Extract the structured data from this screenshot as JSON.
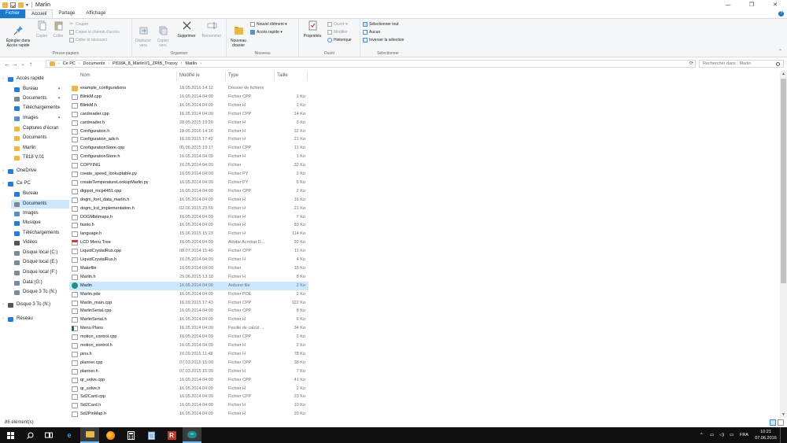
{
  "window": {
    "title": "Marlin",
    "minimize": "—",
    "maximize": "❐",
    "close": "✕"
  },
  "ribbon_tabs": [
    "Fichier",
    "Accueil",
    "Partage",
    "Affichage"
  ],
  "ribbon": {
    "presse_papiers": {
      "label": "Presse-papiers",
      "pin": "Épingler dans\nAccès rapide",
      "copy": "Copier",
      "paste": "Coller",
      "cut": "Couper",
      "copy_path": "Copier le chemin d'accès",
      "paste_shortcut": "Coller le raccourci"
    },
    "organiser": {
      "label": "Organiser",
      "move": "Déplacer\nvers",
      "copy_to": "Copier\nvers",
      "delete": "Supprimer",
      "rename": "Renommer"
    },
    "nouveau": {
      "label": "Nouveau",
      "new_folder": "Nouveau\ndossier",
      "new_item": "Nouvel élément ▾",
      "quick_access": "Accès rapide ▾"
    },
    "ouvrir": {
      "label": "Ouvrir",
      "properties": "Propriétés",
      "open": "Ouvrir ▾",
      "edit": "Modifier",
      "history": "Historique"
    },
    "selectionner": {
      "label": "Sélectionner",
      "select_all": "Sélectionner tout",
      "none": "Aucun",
      "invert": "Inverser la sélection"
    }
  },
  "address": {
    "back": "←",
    "forward": "→",
    "recent": "⌄",
    "up": "↑",
    "crumbs": [
      "Ce PC",
      "Documents",
      "P818A_8_MarlinV1_ZRIB_Tronxy",
      "Marlin"
    ],
    "search_placeholder": "Rechercher dans : Marlin"
  },
  "nav": [
    {
      "label": "Accès rapide",
      "icon": "star-icon",
      "color": "#2b7bd4"
    },
    {
      "label": "Bureau",
      "icon": "desktop-icon",
      "color": "#2b7bd4",
      "pinned": true
    },
    {
      "label": "Documents",
      "icon": "documents-icon",
      "color": "#7a8897",
      "pinned": true
    },
    {
      "label": "Téléchargements",
      "icon": "download-icon",
      "color": "#2b7bd4",
      "pinned": true
    },
    {
      "label": "Images",
      "icon": "images-icon",
      "color": "#5b8fc7",
      "pinned": true
    },
    {
      "label": "Captures d'écran",
      "icon": "folder-icon",
      "color": "#e8b946"
    },
    {
      "label": "Documents",
      "icon": "folder-icon",
      "color": "#e8b946"
    },
    {
      "label": "Marlin",
      "icon": "folder-icon",
      "color": "#e8b946"
    },
    {
      "label": "T818 V.01",
      "icon": "folder-icon",
      "color": "#e8b946"
    },
    {
      "label": "OneDrive",
      "icon": "cloud-icon",
      "color": "#2b7bd4"
    },
    {
      "label": "Ce PC",
      "icon": "computer-icon",
      "color": "#2b7bd4"
    },
    {
      "label": "Bureau",
      "icon": "desktop-icon",
      "color": "#2b7bd4"
    },
    {
      "label": "Documents",
      "icon": "documents-icon",
      "color": "#7a8897"
    },
    {
      "label": "Images",
      "icon": "images-icon",
      "color": "#5b8fc7"
    },
    {
      "label": "Musique",
      "icon": "music-icon",
      "color": "#2b7bd4"
    },
    {
      "label": "Téléchargements",
      "icon": "download-icon",
      "color": "#2b7bd4"
    },
    {
      "label": "Vidéos",
      "icon": "video-icon",
      "color": "#555555"
    },
    {
      "label": "Disque local (C:)",
      "icon": "drive-icon",
      "color": "#7d8b99"
    },
    {
      "label": "Disque local (E:)",
      "icon": "drive-icon",
      "color": "#7d8b99"
    },
    {
      "label": "Disque local (F:)",
      "icon": "drive-icon",
      "color": "#7d8b99"
    },
    {
      "label": "Data  (G:)",
      "icon": "drive-icon",
      "color": "#7d8b99"
    },
    {
      "label": "Disque 3 To (N:)",
      "icon": "drive-icon",
      "color": "#7d8b99"
    },
    {
      "label": "Disque 3 To (N:)",
      "icon": "drive-icon",
      "color": "#555555"
    },
    {
      "label": "Réseau",
      "icon": "network-icon",
      "color": "#2b7bd4"
    }
  ],
  "columns": {
    "name": "Nom",
    "date": "Modifié le",
    "type": "Type",
    "size": "Taille"
  },
  "files": [
    {
      "name": "example_configurations",
      "date": "18.05.2016 14:12",
      "type": "Dossier de fichiers",
      "size": "",
      "kind": "folder"
    },
    {
      "name": "BlinkM.cpp",
      "date": "16.05.2014 04:09",
      "type": "Fichier CPP",
      "size": "1 Ko",
      "kind": "file"
    },
    {
      "name": "BlinkM.h",
      "date": "16.05.2014 04:09",
      "type": "Fichier H",
      "size": "1 Ko",
      "kind": "file"
    },
    {
      "name": "cardreader.cpp",
      "date": "16.05.2014 04:09",
      "type": "Fichier CPP",
      "size": "14 Ko",
      "kind": "file"
    },
    {
      "name": "cardreader.h",
      "date": "28.05.2015 19:20",
      "type": "Fichier H",
      "size": "3 Ko",
      "kind": "file"
    },
    {
      "name": "Configuration.h",
      "date": "18.05.2016 14:16",
      "type": "Fichier H",
      "size": "32 Ko",
      "kind": "file"
    },
    {
      "name": "Configuration_adv.h",
      "date": "16.09.2015 17:42",
      "type": "Fichier H",
      "size": "21 Ko",
      "kind": "file"
    },
    {
      "name": "ConfigurationStore.cpp",
      "date": "05.06.2015 19:17",
      "type": "Fichier CPP",
      "size": "11 Ko",
      "kind": "file"
    },
    {
      "name": "ConfigurationStore.h",
      "date": "16.05.2014 04:09",
      "type": "Fichier H",
      "size": "1 Ko",
      "kind": "file"
    },
    {
      "name": "COPYING",
      "date": "16.05.2014 04:09",
      "type": "Fichier",
      "size": "32 Ko",
      "kind": "file"
    },
    {
      "name": "create_speed_lookuptable.py",
      "date": "16.05.2014 04:09",
      "type": "Fichier PY",
      "size": "2 Ko",
      "kind": "file"
    },
    {
      "name": "createTemperatureLookupMarlin.py",
      "date": "16.05.2014 04:09",
      "type": "Fichier PY",
      "size": "6 Ko",
      "kind": "file"
    },
    {
      "name": "digipot_mcp4451.cpp",
      "date": "16.05.2014 04:09",
      "type": "Fichier CPP",
      "size": "2 Ko",
      "kind": "file"
    },
    {
      "name": "dogm_font_data_marlin.h",
      "date": "16.05.2014 04:09",
      "type": "Fichier H",
      "size": "16 Ko",
      "kind": "file"
    },
    {
      "name": "dogm_lcd_implementation.h",
      "date": "02.06.2015 23:59",
      "type": "Fichier H",
      "size": "21 Ko",
      "kind": "file"
    },
    {
      "name": "DOGMbitmaps.h",
      "date": "16.05.2014 04:09",
      "type": "Fichier H",
      "size": "7 Ko",
      "kind": "file"
    },
    {
      "name": "fastio.h",
      "date": "16.05.2014 04:09",
      "type": "Fichier H",
      "size": "83 Ko",
      "kind": "file"
    },
    {
      "name": "language.h",
      "date": "15.06.2015 15:23",
      "type": "Fichier H",
      "size": "114 Ko",
      "kind": "file"
    },
    {
      "name": "LCD Menu Tree",
      "date": "16.05.2014 04:09",
      "type": "Adobe Acrobat D...",
      "size": "92 Ko",
      "kind": "pdf"
    },
    {
      "name": "LiquidCrystalRus.cpp",
      "date": "08.07.2014 15:40",
      "type": "Fichier CPP",
      "size": "11 Ko",
      "kind": "file"
    },
    {
      "name": "LiquidCrystalRus.h",
      "date": "16.05.2014 04:09",
      "type": "Fichier H",
      "size": "4 Ko",
      "kind": "file"
    },
    {
      "name": "Makefile",
      "date": "16.05.2014 04:09",
      "type": "Fichier",
      "size": "15 Ko",
      "kind": "file"
    },
    {
      "name": "Marlin.h",
      "date": "29.06.2015 13:18",
      "type": "Fichier H",
      "size": "8 Ko",
      "kind": "file"
    },
    {
      "name": "Marlin",
      "date": "16.05.2014 04:09",
      "type": "Arduino file",
      "size": "2 Ko",
      "kind": "ino",
      "selected": true
    },
    {
      "name": "Marlin.pde",
      "date": "16.05.2014 04:09",
      "type": "Fichier PDE",
      "size": "2 Ko",
      "kind": "file"
    },
    {
      "name": "Marlin_main.cpp",
      "date": "16.09.2015 17:43",
      "type": "Fichier CPP",
      "size": "122 Ko",
      "kind": "file"
    },
    {
      "name": "MarlinSerial.cpp",
      "date": "16.05.2014 04:09",
      "type": "Fichier CPP",
      "size": "8 Ko",
      "kind": "file"
    },
    {
      "name": "MarlinSerial.h",
      "date": "16.05.2014 04:09",
      "type": "Fichier H",
      "size": "6 Ko",
      "kind": "file"
    },
    {
      "name": "Menu Plans",
      "date": "16.05.2014 04:09",
      "type": "Feuille de calcul ...",
      "size": "34 Ko",
      "kind": "xls"
    },
    {
      "name": "motion_control.cpp",
      "date": "16.05.2014 04:09",
      "type": "Fichier CPP",
      "size": "2 Ko",
      "kind": "file"
    },
    {
      "name": "motion_control.h",
      "date": "16.05.2014 04:09",
      "type": "Fichier H",
      "size": "2 Ko",
      "kind": "file"
    },
    {
      "name": "pins.h",
      "date": "16.09.2015 11:48",
      "type": "Fichier H",
      "size": "78 Ko",
      "kind": "file"
    },
    {
      "name": "planner.cpp",
      "date": "07.03.2015 15:09",
      "type": "Fichier CPP",
      "size": "38 Ko",
      "kind": "file"
    },
    {
      "name": "planner.h",
      "date": "07.03.2015 15:09",
      "type": "Fichier H",
      "size": "7 Ko",
      "kind": "file"
    },
    {
      "name": "qr_solve.cpp",
      "date": "16.05.2014 04:09",
      "type": "Fichier CPP",
      "size": "41 Ko",
      "kind": "file"
    },
    {
      "name": "qr_solve.h",
      "date": "16.05.2014 04:09",
      "type": "Fichier H",
      "size": "2 Ko",
      "kind": "file"
    },
    {
      "name": "Sd2Card.cpp",
      "date": "16.05.2014 04:09",
      "type": "Fichier CPP",
      "size": "23 Ko",
      "kind": "file"
    },
    {
      "name": "Sd2Card.h",
      "date": "16.05.2014 04:09",
      "type": "Fichier H",
      "size": "10 Ko",
      "kind": "file"
    },
    {
      "name": "Sd2PinMap.h",
      "date": "16.05.2014 04:09",
      "type": "Fichier H",
      "size": "20 Ko",
      "kind": "file"
    }
  ],
  "status": {
    "count": "86 élément(s)"
  },
  "taskbar": {
    "apps": [
      "start",
      "search",
      "task-view",
      "edge",
      "explorer",
      "firefox",
      "calculator",
      "notepad",
      "app-r",
      "arduino"
    ],
    "tray": {
      "chevron": "^",
      "lang": "FRA",
      "time": "10:21",
      "date": "07.06.2016"
    }
  },
  "colors": {
    "accent": "#1979ca",
    "selection": "#cce8ff",
    "folder": "#e8b946",
    "taskbar": "#101010"
  }
}
